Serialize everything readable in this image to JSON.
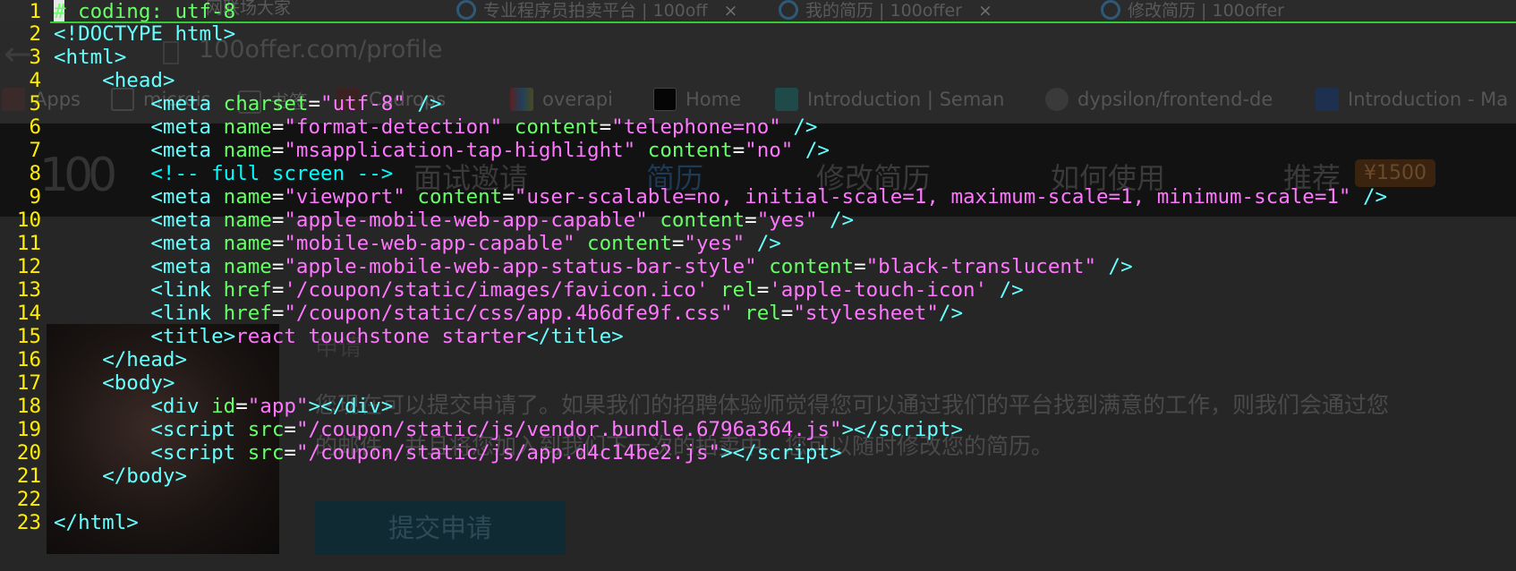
{
  "background": {
    "tabs": [
      {
        "label": "网联场大家"
      },
      {
        "label": "专业程序员拍卖平台 | 100off"
      },
      {
        "label": "我的简历 | 100offer"
      },
      {
        "label": "修改简历 | 100offer"
      }
    ],
    "tab_close": "×",
    "url_domain": "100offer.com",
    "url_path": "/profile",
    "bookmarks": [
      {
        "label": "Apps"
      },
      {
        "label": "microis"
      },
      {
        "label": "书签"
      },
      {
        "label": "Codrops"
      },
      {
        "label": "overapi"
      },
      {
        "label": "Home"
      },
      {
        "label": "Introduction | Seman"
      },
      {
        "label": "dypsilon/frontend-de"
      },
      {
        "label": "Introduction - Ma"
      }
    ],
    "nav": {
      "logo": "100",
      "items": [
        {
          "label": "面试邀请"
        },
        {
          "label": "简历"
        },
        {
          "label": "修改简历"
        },
        {
          "label": "如何使用"
        },
        {
          "label": "推荐"
        }
      ],
      "badge": "¥1500"
    },
    "page_title": "申请",
    "paragraph_line1": "您现在可以提交申请了。如果我们的招聘体验师觉得您可以通过我们的平台找到满意的工作，则我们会通过您",
    "paragraph_line2": "的邮件，并且将您加入到我们下一次的拍卖中。您可以随时修改您的简历。",
    "submit_button": "提交申请"
  },
  "editor": {
    "line_numbers": [
      "1",
      "2",
      "3",
      "4",
      "5",
      "6",
      "7",
      "8",
      "9",
      "10",
      "11",
      "12",
      "13",
      "14",
      "15",
      "16",
      "17",
      "18",
      "19",
      "20",
      "21",
      "22",
      "23"
    ],
    "line1_comment": "# coding: utf-8",
    "doctype": "<!DOCTYPE html>",
    "html_open": "<html>",
    "head_open": "<head>",
    "meta_charset": {
      "attr": "charset",
      "value": "\"utf-8\""
    },
    "meta_format": {
      "name": "\"format-detection\"",
      "content": "\"telephone=no\""
    },
    "meta_ms": {
      "name": "\"msapplication-tap-highlight\"",
      "content": "\"no\""
    },
    "comment_fullscreen": "<!-- full screen -->",
    "meta_viewport": {
      "name": "\"viewport\"",
      "content": "\"user-scalable=no, initial-scale=1, maximum-scale=1, minimum-scale=1\""
    },
    "meta_apple_capable": {
      "name": "\"apple-mobile-web-app-capable\"",
      "content": "\"yes\""
    },
    "meta_mobile_capable": {
      "name": "\"mobile-web-app-capable\"",
      "content": "\"yes\""
    },
    "meta_status_bar": {
      "name": "\"apple-mobile-web-app-status-bar-style\"",
      "content": "\"black-translucent\""
    },
    "link_icon": {
      "href": "'/coupon/static/images/favicon.ico'",
      "rel": "'apple-touch-icon'"
    },
    "link_css": {
      "href": "\"/coupon/static/css/app.4b6dfe9f.css\"",
      "rel": "\"stylesheet\""
    },
    "title_text": "react touchstone starter",
    "head_close": "</head>",
    "body_open": "<body>",
    "div_id": "\"app\"",
    "script_vendor": "\"/coupon/static/js/vendor.bundle.6796a364.js\"",
    "script_app": "\"/coupon/static/js/app.d4c14be2.js\"",
    "body_close": "</body>",
    "html_close": "</html>"
  },
  "colors": {
    "line_number": "#ffee00",
    "tag": "#66ffff",
    "attribute": "#66ff66",
    "string": "#ff77ff",
    "comment": "#00ffff",
    "cursorline": "#33cc33"
  }
}
